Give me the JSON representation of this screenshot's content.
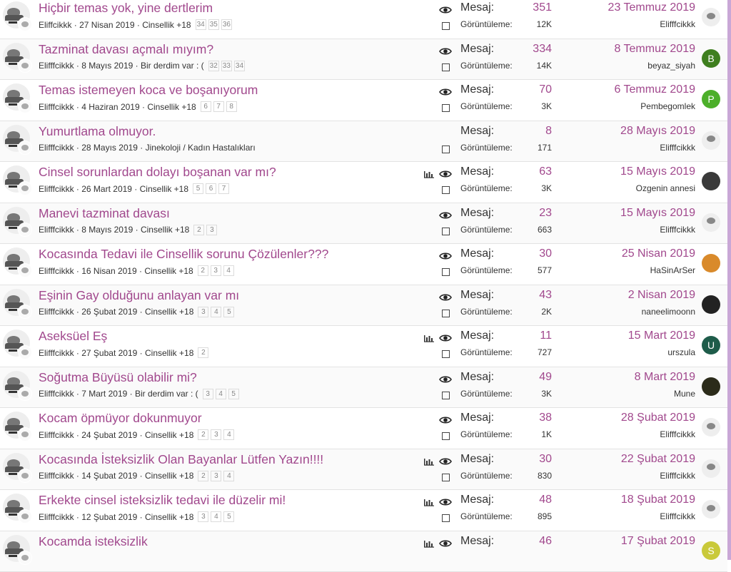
{
  "threads": [
    {
      "title": "Hiçbir temas yok, yine dertlerim",
      "author": "Eliffcikkk",
      "date": "27 Nisan 2019",
      "forum": "Cinsellik +18",
      "pages": [
        "34",
        "35",
        "36"
      ],
      "chart": false,
      "eye": true,
      "replies_label": "Mesaj:",
      "replies": "351",
      "views_label": "Görüntüleme:",
      "views": "12K",
      "last_date": "23 Temmuz 2019",
      "last_user": "Elifffcikkk",
      "last_avatar": {
        "type": "default"
      }
    },
    {
      "title": "Tazminat davası açmalı mıyım?",
      "author": "Elifffcikkk",
      "date": "8 Mayıs 2019",
      "forum": "Bir derdim var : (",
      "pages": [
        "32",
        "33",
        "34"
      ],
      "chart": false,
      "eye": true,
      "replies_label": "Mesaj:",
      "replies": "334",
      "views_label": "Görüntüleme:",
      "views": "14K",
      "last_date": "8 Temmuz 2019",
      "last_user": "beyaz_siyah",
      "last_avatar": {
        "type": "letter",
        "letter": "B",
        "color": "#3f7f1f"
      }
    },
    {
      "title": "Temas istemeyen koca ve boşanıyorum",
      "author": "Elifffcikkk",
      "date": "4 Haziran 2019",
      "forum": "Cinsellik +18",
      "pages": [
        "6",
        "7",
        "8"
      ],
      "chart": false,
      "eye": true,
      "replies_label": "Mesaj:",
      "replies": "70",
      "views_label": "Görüntüleme:",
      "views": "3K",
      "last_date": "6 Temmuz 2019",
      "last_user": "Pembegomlek",
      "last_avatar": {
        "type": "letter",
        "letter": "P",
        "color": "#4caf2a"
      }
    },
    {
      "title": "Yumurtlama olmuyor.",
      "author": "Elifffcikkk",
      "date": "28 Mayıs 2019",
      "forum": "Jinekoloji / Kadın Hastalıkları",
      "pages": [],
      "chart": false,
      "eye": false,
      "replies_label": "Mesaj:",
      "replies": "8",
      "views_label": "Görüntüleme:",
      "views": "171",
      "last_date": "28 Mayıs 2019",
      "last_user": "Elifffcikkk",
      "last_avatar": {
        "type": "default"
      }
    },
    {
      "title": "Cinsel sorunlardan dolayı boşanan var mı?",
      "author": "Elifffcikkk",
      "date": "26 Mart 2019",
      "forum": "Cinsellik +18",
      "pages": [
        "5",
        "6",
        "7"
      ],
      "chart": true,
      "eye": true,
      "replies_label": "Mesaj:",
      "replies": "63",
      "views_label": "Görüntüleme:",
      "views": "3K",
      "last_date": "15 Mayıs 2019",
      "last_user": "Ozgenin annesi",
      "last_avatar": {
        "type": "photo",
        "color": "#3a3a3a"
      }
    },
    {
      "title": "Manevi tazminat davası",
      "author": "Elifffcikkk",
      "date": "8 Mayıs 2019",
      "forum": "Cinsellik +18",
      "pages": [
        "2",
        "3"
      ],
      "chart": false,
      "eye": true,
      "replies_label": "Mesaj:",
      "replies": "23",
      "views_label": "Görüntüleme:",
      "views": "663",
      "last_date": "15 Mayıs 2019",
      "last_user": "Elifffcikkk",
      "last_avatar": {
        "type": "default"
      }
    },
    {
      "title": "Kocasında Tedavi ile Cinsellik sorunu Çözülenler???",
      "author": "Elifffcikkk",
      "date": "16 Nisan 2019",
      "forum": "Cinsellik +18",
      "pages": [
        "2",
        "3",
        "4"
      ],
      "chart": false,
      "eye": true,
      "replies_label": "Mesaj:",
      "replies": "30",
      "views_label": "Görüntüleme:",
      "views": "577",
      "last_date": "25 Nisan 2019",
      "last_user": "HaSinArSer",
      "last_avatar": {
        "type": "photo",
        "color": "#d98a2b"
      }
    },
    {
      "title": "Eşinin Gay olduğunu anlayan var mı",
      "author": "Elifffcikkk",
      "date": "26 Şubat 2019",
      "forum": "Cinsellik +18",
      "pages": [
        "3",
        "4",
        "5"
      ],
      "chart": false,
      "eye": true,
      "replies_label": "Mesaj:",
      "replies": "43",
      "views_label": "Görüntüleme:",
      "views": "2K",
      "last_date": "2 Nisan 2019",
      "last_user": "naneelimoonn",
      "last_avatar": {
        "type": "photo",
        "color": "#222222"
      }
    },
    {
      "title": "Aseksüel Eş",
      "author": "Elifffcikkk",
      "date": "27 Şubat 2019",
      "forum": "Cinsellik +18",
      "pages": [
        "2"
      ],
      "chart": true,
      "eye": true,
      "replies_label": "Mesaj:",
      "replies": "11",
      "views_label": "Görüntüleme:",
      "views": "727",
      "last_date": "15 Mart 2019",
      "last_user": "urszula",
      "last_avatar": {
        "type": "letter",
        "letter": "U",
        "color": "#1e5c4a"
      }
    },
    {
      "title": "Soğutma Büyüsü olabilir mi?",
      "author": "Elifffcikkk",
      "date": "7 Mart 2019",
      "forum": "Bir derdim var : (",
      "pages": [
        "3",
        "4",
        "5"
      ],
      "chart": false,
      "eye": true,
      "replies_label": "Mesaj:",
      "replies": "49",
      "views_label": "Görüntüleme:",
      "views": "3K",
      "last_date": "8 Mart 2019",
      "last_user": "Mune",
      "last_avatar": {
        "type": "photo",
        "color": "#2b2b1a"
      }
    },
    {
      "title": "Kocam öpmüyor dokunmuyor",
      "author": "Elifffcikkk",
      "date": "24 Şubat 2019",
      "forum": "Cinsellik +18",
      "pages": [
        "2",
        "3",
        "4"
      ],
      "chart": false,
      "eye": true,
      "replies_label": "Mesaj:",
      "replies": "38",
      "views_label": "Görüntüleme:",
      "views": "1K",
      "last_date": "28 Şubat 2019",
      "last_user": "Elifffcikkk",
      "last_avatar": {
        "type": "default"
      }
    },
    {
      "title": "Kocasında İsteksizlik Olan Bayanlar Lütfen Yazın!!!!",
      "author": "Elifffcikkk",
      "date": "14 Şubat 2019",
      "forum": "Cinsellik +18",
      "pages": [
        "2",
        "3",
        "4"
      ],
      "chart": true,
      "eye": true,
      "replies_label": "Mesaj:",
      "replies": "30",
      "views_label": "Görüntüleme:",
      "views": "830",
      "last_date": "22 Şubat 2019",
      "last_user": "Elifffcikkk",
      "last_avatar": {
        "type": "default"
      }
    },
    {
      "title": "Erkekte cinsel isteksizlik tedavi ile düzelir mi!",
      "author": "Elifffcikkk",
      "date": "12 Şubat 2019",
      "forum": "Cinsellik +18",
      "pages": [
        "3",
        "4",
        "5"
      ],
      "chart": true,
      "eye": true,
      "replies_label": "Mesaj:",
      "replies": "48",
      "views_label": "Görüntüleme:",
      "views": "895",
      "last_date": "18 Şubat 2019",
      "last_user": "Elifffcikkk",
      "last_avatar": {
        "type": "default"
      }
    },
    {
      "title": "Kocamda isteksizlik",
      "author": "",
      "date": "",
      "forum": "",
      "pages": [],
      "chart": true,
      "eye": true,
      "replies_label": "Mesaj:",
      "replies": "46",
      "views_label": "",
      "views": "",
      "last_date": "17 Şubat 2019",
      "last_user": "",
      "last_avatar": {
        "type": "letter",
        "letter": "S",
        "color": "#c9c93a"
      }
    }
  ]
}
